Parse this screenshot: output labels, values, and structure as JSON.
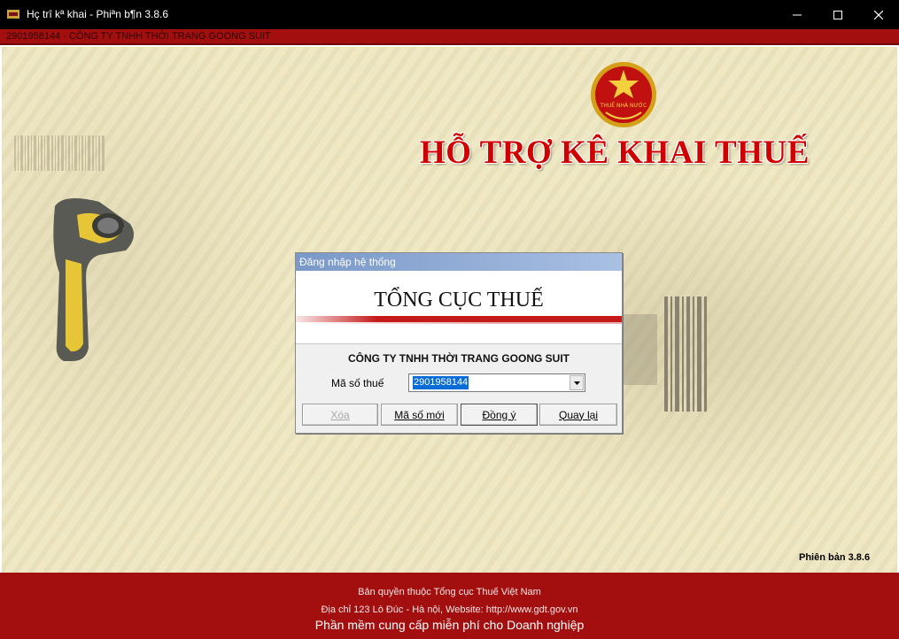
{
  "window": {
    "title": "Hç trî kª khai - Phiªn b¶n 3.8.6",
    "icon": "app-logo-icon",
    "controls": [
      "minimize-icon",
      "maximize-icon",
      "close-icon"
    ]
  },
  "company_bar": {
    "text": "2901958144 · CÔNG TY TNHH THỜI TRANG GOONG SUIT"
  },
  "header": {
    "emblem_text": "THUẾ NHÀ NƯỚC",
    "headline": "HỖ TRỢ KÊ KHAI THUẾ"
  },
  "dialog": {
    "title": "Đăng nhập hệ thống",
    "brand": "TỔNG CỤC THUẾ",
    "company_name": "CÔNG TY TNHH THỜI TRANG GOONG SUIT",
    "mst_label": "Mã số thuế",
    "mst_value": "2901958144",
    "buttons": {
      "delete": "Xóa",
      "new_mst": "Mã số mới",
      "agree": "Đồng ý",
      "back": "Quay lại"
    }
  },
  "version_label": "Phiên bản 3.8.6",
  "footer": {
    "copyright": "Bản quyền thuộc Tổng cục Thuế Việt Nam",
    "address": "Địa chỉ 123 Lò Đúc - Hà nội,  Website: http://www.gdt.gov.vn",
    "tagline": "Phần mềm cung cấp miễn phí cho Doanh nghiệp"
  },
  "colors": {
    "brand_red": "#a30f0f",
    "headline_red": "#d10000",
    "background": "#efe8c4",
    "selection_blue": "#0a6cd6"
  }
}
